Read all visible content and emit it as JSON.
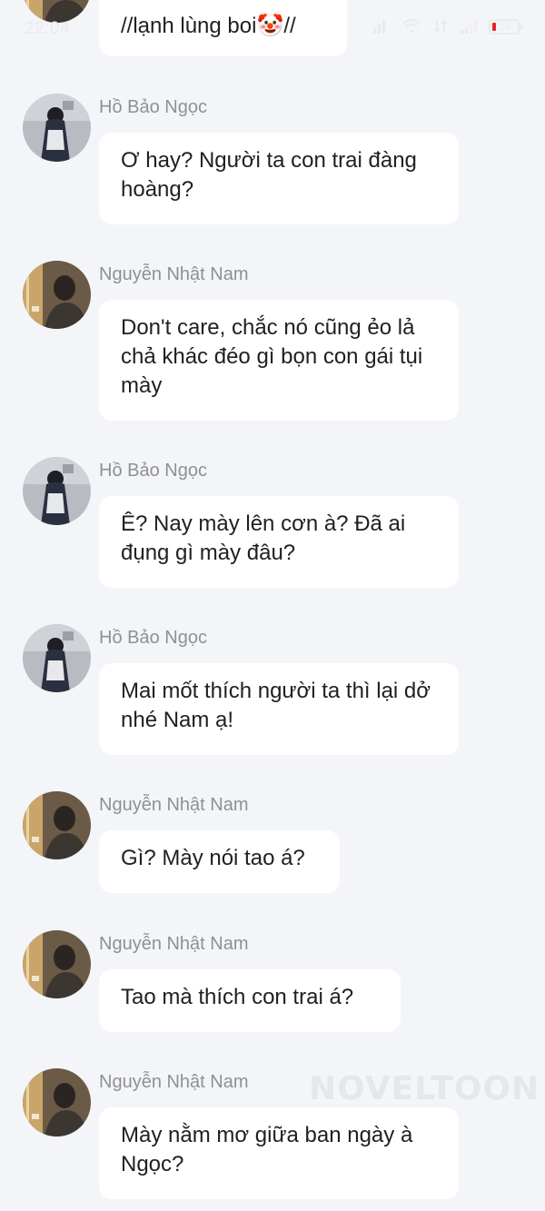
{
  "status_bar": {
    "time": "22:04",
    "battery": "16",
    "icons": [
      "signal-icon",
      "wifi-icon",
      "data-icon",
      "cell-signal-icon",
      "battery-icon"
    ]
  },
  "messages": [
    {
      "sender": "",
      "avatar": "nam",
      "text": "//lạnh lùng boi🤡//"
    },
    {
      "sender": "Hồ Bảo Ngọc",
      "avatar": "ngoc",
      "text": "Ơ hay? Người ta con trai đàng hoàng?"
    },
    {
      "sender": "Nguyễn Nhật Nam",
      "avatar": "nam",
      "text": "Don't care, chắc nó cũng ẻo lả chả khác đéo gì bọn con gái tụi mày"
    },
    {
      "sender": "Hồ Bảo Ngọc",
      "avatar": "ngoc",
      "text": "Ê? Nay mày lên cơn à? Đã ai đụng gì mày đâu?"
    },
    {
      "sender": "Hồ Bảo Ngọc",
      "avatar": "ngoc",
      "text": "Mai mốt thích người ta thì lại dở nhé Nam ạ!"
    },
    {
      "sender": "Nguyễn Nhật Nam",
      "avatar": "nam",
      "text": "Gì? Mày nói tao á?"
    },
    {
      "sender": "Nguyễn Nhật Nam",
      "avatar": "nam",
      "text": "Tao mà thích con trai á?"
    },
    {
      "sender": "Nguyễn Nhật Nam",
      "avatar": "nam",
      "text": "Mày nằm mơ giữa ban ngày à Ngọc?"
    }
  ],
  "watermark": "NOVELTOON"
}
